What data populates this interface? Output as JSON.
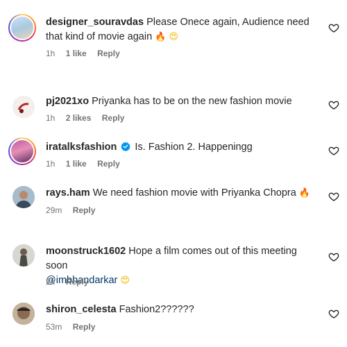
{
  "comments": [
    {
      "username": "designer_souravdas",
      "text": "Please Onece again, Audience need that kind of movie again",
      "emojis": [
        "🔥",
        "😍"
      ],
      "time": "1h",
      "likes": "1 like",
      "reply_label": "Reply",
      "avatar_ring": true
    },
    {
      "username": "pj2021xo",
      "text": "Priyanka has to be on the new fashion movie",
      "time": "1h",
      "likes": "2 likes",
      "reply_label": "Reply"
    },
    {
      "username": "iratalksfashion",
      "verified": true,
      "text": "Is. Fashion 2. Happeningg",
      "time": "1h",
      "likes": "1 like",
      "reply_label": "Reply",
      "avatar_ring": true
    },
    {
      "username": "rays.ham",
      "text": "We need fashion movie with Priyanka Chopra",
      "emojis": [
        "🔥"
      ],
      "time": "29m",
      "reply_label": "Reply"
    },
    {
      "username": "moonstruck1602",
      "text": "Hope a film comes out of this meeting soon",
      "mention": "@imbhandarkar",
      "emojis": [
        "😍"
      ],
      "time": "2h",
      "reply_label": "Reply"
    },
    {
      "username": "shiron_celesta",
      "text": "Fashion2??????",
      "time": "53m",
      "reply_label": "Reply"
    }
  ],
  "colors": {
    "text": "#262626",
    "meta": "#737373",
    "mention": "#00376b",
    "verified": "#0095f6"
  },
  "icons": [
    "heart-outline-icon",
    "verified-badge-icon",
    "fire-emoji",
    "heart-eyes-emoji"
  ]
}
